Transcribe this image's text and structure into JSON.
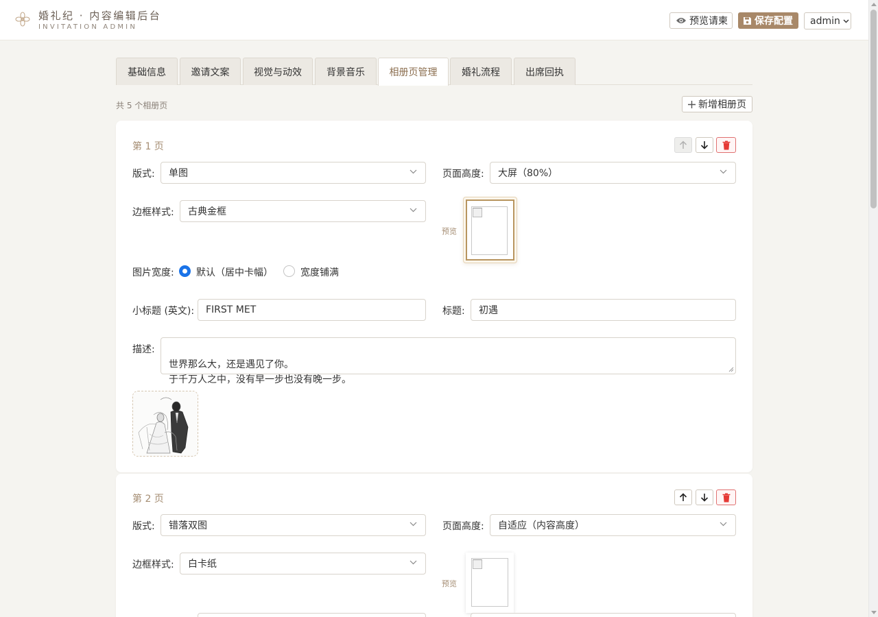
{
  "header": {
    "brand_title": "婚礼纪 · 内容编辑后台",
    "brand_subtitle": "INVITATION ADMIN",
    "preview_label": "预览请柬",
    "save_label": "保存配置",
    "user_label": "admin"
  },
  "tabs": [
    {
      "label": "基础信息"
    },
    {
      "label": "邀请文案"
    },
    {
      "label": "视觉与动效"
    },
    {
      "label": "背景音乐"
    },
    {
      "label": "相册页管理",
      "active": true
    },
    {
      "label": "婚礼流程"
    },
    {
      "label": "出席回执"
    }
  ],
  "album": {
    "count_label": "共 5 个相册页",
    "add_label": "新增相册页"
  },
  "labels": {
    "layout": "版式:",
    "page_height": "页面高度:",
    "border_style": "边框样式:",
    "preview": "预览",
    "image_width": "图片宽度:",
    "subtitle_en": "小标题 (英文):",
    "title": "标题:",
    "description": "描述:"
  },
  "pages": [
    {
      "title": "第 1 页",
      "layout": "单图",
      "page_height": "大屏（80%）",
      "border_style": "古典金框",
      "width_options": [
        "默认（居中卡幅）",
        "宽度铺满"
      ],
      "width_selected": 0,
      "subtitle_en": "FIRST MET",
      "title_value": "初遇",
      "description": "世界那么大，还是遇见了你。\n于千万人之中，没有早一步也没有晚一步。",
      "up_disabled": true
    },
    {
      "title": "第 2 页",
      "layout": "错落双图",
      "page_height": "自适应（内容高度）",
      "border_style": "白卡纸",
      "up_disabled": false
    }
  ],
  "icons": {
    "logo": "flower-icon",
    "preview": "eye-icon",
    "save": "floppy-disk-icon",
    "user_menu": "chevron-down-icon",
    "add": "plus-icon",
    "move_up": "arrow-up-icon",
    "move_down": "arrow-down-icon",
    "delete": "trash-icon"
  },
  "colors": {
    "accent": "#a88868",
    "accent_text": "#a58d73",
    "radio_checked": "#1a73e8",
    "danger": "#e53935",
    "page_bg": "#f5f4f0"
  }
}
